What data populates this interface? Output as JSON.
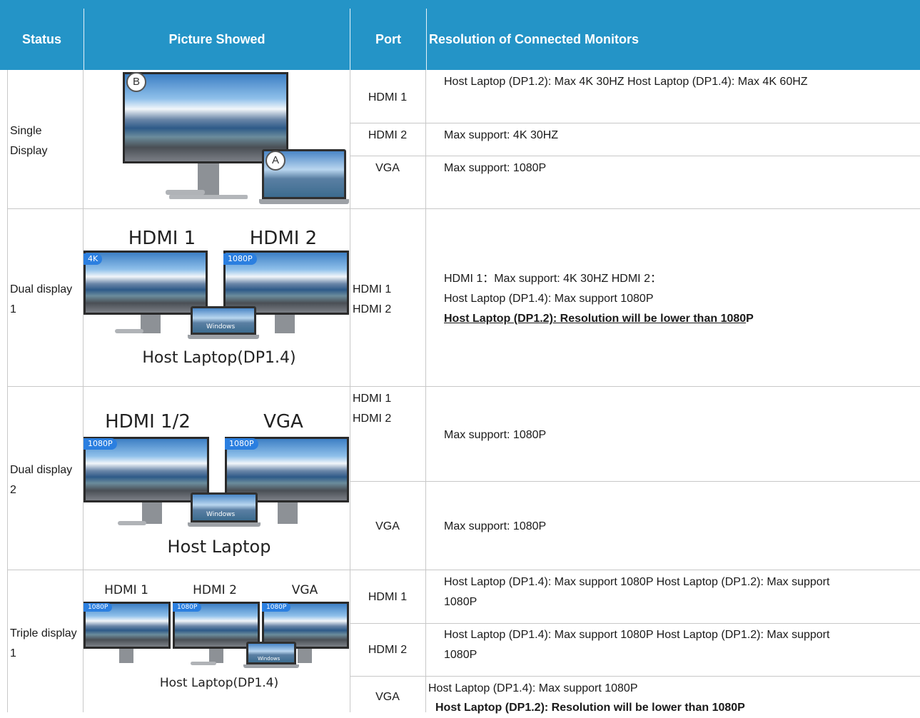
{
  "headers": {
    "status": "Status",
    "picture": "Picture Showed",
    "port": "Port",
    "resolution": "Resolution  of  Connected Monitors"
  },
  "rows": [
    {
      "status": "Single Display",
      "picture": {
        "monitor_marker": "B",
        "laptop_marker": "A"
      },
      "ports": [
        {
          "port": "HDMI 1",
          "resolution": "Host Laptop (DP1.2): Max 4K 30HZ Host Laptop (DP1.4): Max 4K 60HZ"
        },
        {
          "port": "HDMI 2",
          "resolution": "Max support: 4K 30HZ"
        },
        {
          "port": "VGA",
          "resolution": "Max support: 1080P"
        }
      ]
    },
    {
      "status": "Dual display 1",
      "picture": {
        "label_left": "HDMI 1",
        "label_right": "HDMI 2",
        "badge_left": "4K",
        "badge_right": "1080P",
        "screen_text": "Windows",
        "caption": "Host Laptop(DP1.4)"
      },
      "port_lines": [
        "HDMI 1",
        "HDMI 2"
      ],
      "resolution_lines": [
        "HDMI 1：Max support: 4K 30HZ HDMI 2：",
        "Host Laptop (DP1.4): Max support  1080P"
      ],
      "resolution_bold_underlined": "Host Laptop (DP1.2):  Resolution will be lower than 1080",
      "resolution_bold_suffix": "P"
    },
    {
      "status": "Dual display 2",
      "picture": {
        "label_left": "HDMI 1/2",
        "label_right": "VGA",
        "badge_left": "1080P",
        "badge_right": "1080P",
        "screen_text": "Windows",
        "caption": "Host Laptop"
      },
      "ports": [
        {
          "port_lines": [
            "HDMI 1",
            "HDMI 2"
          ],
          "resolution": "Max support: 1080P"
        },
        {
          "port": "VGA",
          "resolution": "Max support: 1080P"
        }
      ]
    },
    {
      "status": "Triple display 1",
      "picture": {
        "label_1": "HDMI 1",
        "label_2": "HDMI 2",
        "label_3": "VGA",
        "badge_1": "1080P",
        "badge_2": "1080P",
        "badge_3": "1080P",
        "screen_text": "Windows",
        "caption": "Host Laptop(DP1.4)"
      },
      "ports": [
        {
          "port": "HDMI 1",
          "resolution_lines": [
            "Host Laptop (DP1.4): Max support 1080P Host Laptop (DP1.2): Max support",
            "1080P"
          ]
        },
        {
          "port": "HDMI 2",
          "resolution_lines": [
            "Host Laptop (DP1.4): Max support 1080P Host Laptop (DP1.2): Max support",
            "1080P"
          ]
        },
        {
          "port": "VGA",
          "resolution": "Host Laptop (DP1.4): Max support 1080P",
          "resolution_bold": "Host Laptop (DP1.2): Resolution will be lower than 1080P"
        }
      ]
    }
  ],
  "colors": {
    "header_bg": "#2494c7",
    "header_text": "#ffffff",
    "grid": "#c8c8c8",
    "badge": "#2b7fe0"
  }
}
